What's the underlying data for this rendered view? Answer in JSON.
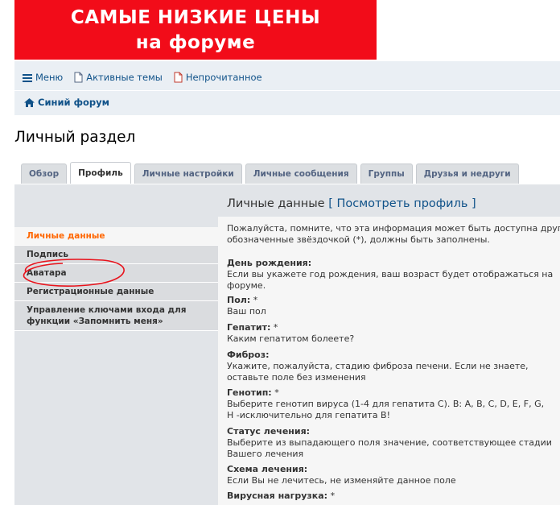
{
  "banner": {
    "line1": "САМЫЕ НИЗКИЕ ЦЕНЫ",
    "line2": "на форуме"
  },
  "nav": {
    "menu": "Меню",
    "active_topics": "Активные темы",
    "unread": "Непрочитанное",
    "forum_name": "Синий форум"
  },
  "page_title": "Личный раздел",
  "tabs": [
    "Обзор",
    "Профиль",
    "Личные настройки",
    "Личные сообщения",
    "Группы",
    "Друзья и недруги"
  ],
  "sidebar": {
    "items": [
      "Личные данные",
      "Подпись",
      "Аватара",
      "Регистрационные данные",
      "Управление ключами входа для",
      "функции «Запомнить меня»"
    ]
  },
  "content": {
    "title": "Личные данные",
    "view_profile": "Посмотреть профиль",
    "intro1": "Пожалуйста, помните, что эта информация может быть доступна другим",
    "intro2": "обозначенные звёздочкой (*), должны быть заполнены.",
    "fields": [
      {
        "label": "День рождения:",
        "desc1": "Если вы укажете год рождения, ваш возраст будет отображаться на",
        "desc2": "форуме."
      },
      {
        "label": "Пол:",
        "req": " *",
        "desc1": "Ваш пол"
      },
      {
        "label": "Гепатит:",
        "req": " *",
        "desc1": "Каким гепатитом болеете?"
      },
      {
        "label": "Фиброз:",
        "desc1": "Укажите, пожалуйста, стадию фиброза печени. Если не знаете,",
        "desc2": "оставьте поле без изменения"
      },
      {
        "label": "Генотип:",
        "req": " *",
        "desc1": "Выберите генотип вируса (1-4 для гепатита C). В: A, B, C, D, E, F, G,",
        "desc2": "H -исключительно для гепатита В!"
      },
      {
        "label": "Статус лечения:",
        "desc1": "Выберите из выпадающего поля значение, соответствующее стадии",
        "desc2": "Вашего лечения"
      },
      {
        "label": "Схема лечения:",
        "desc1": "Если Вы не лечитесь, не изменяйте данное поле"
      },
      {
        "label": "Вирусная нагрузка:",
        "req": " *"
      }
    ]
  },
  "colors": {
    "banner": "#f20c19",
    "link": "#105289",
    "active_menu": "#ff6600",
    "annotation": "#e8131c"
  }
}
